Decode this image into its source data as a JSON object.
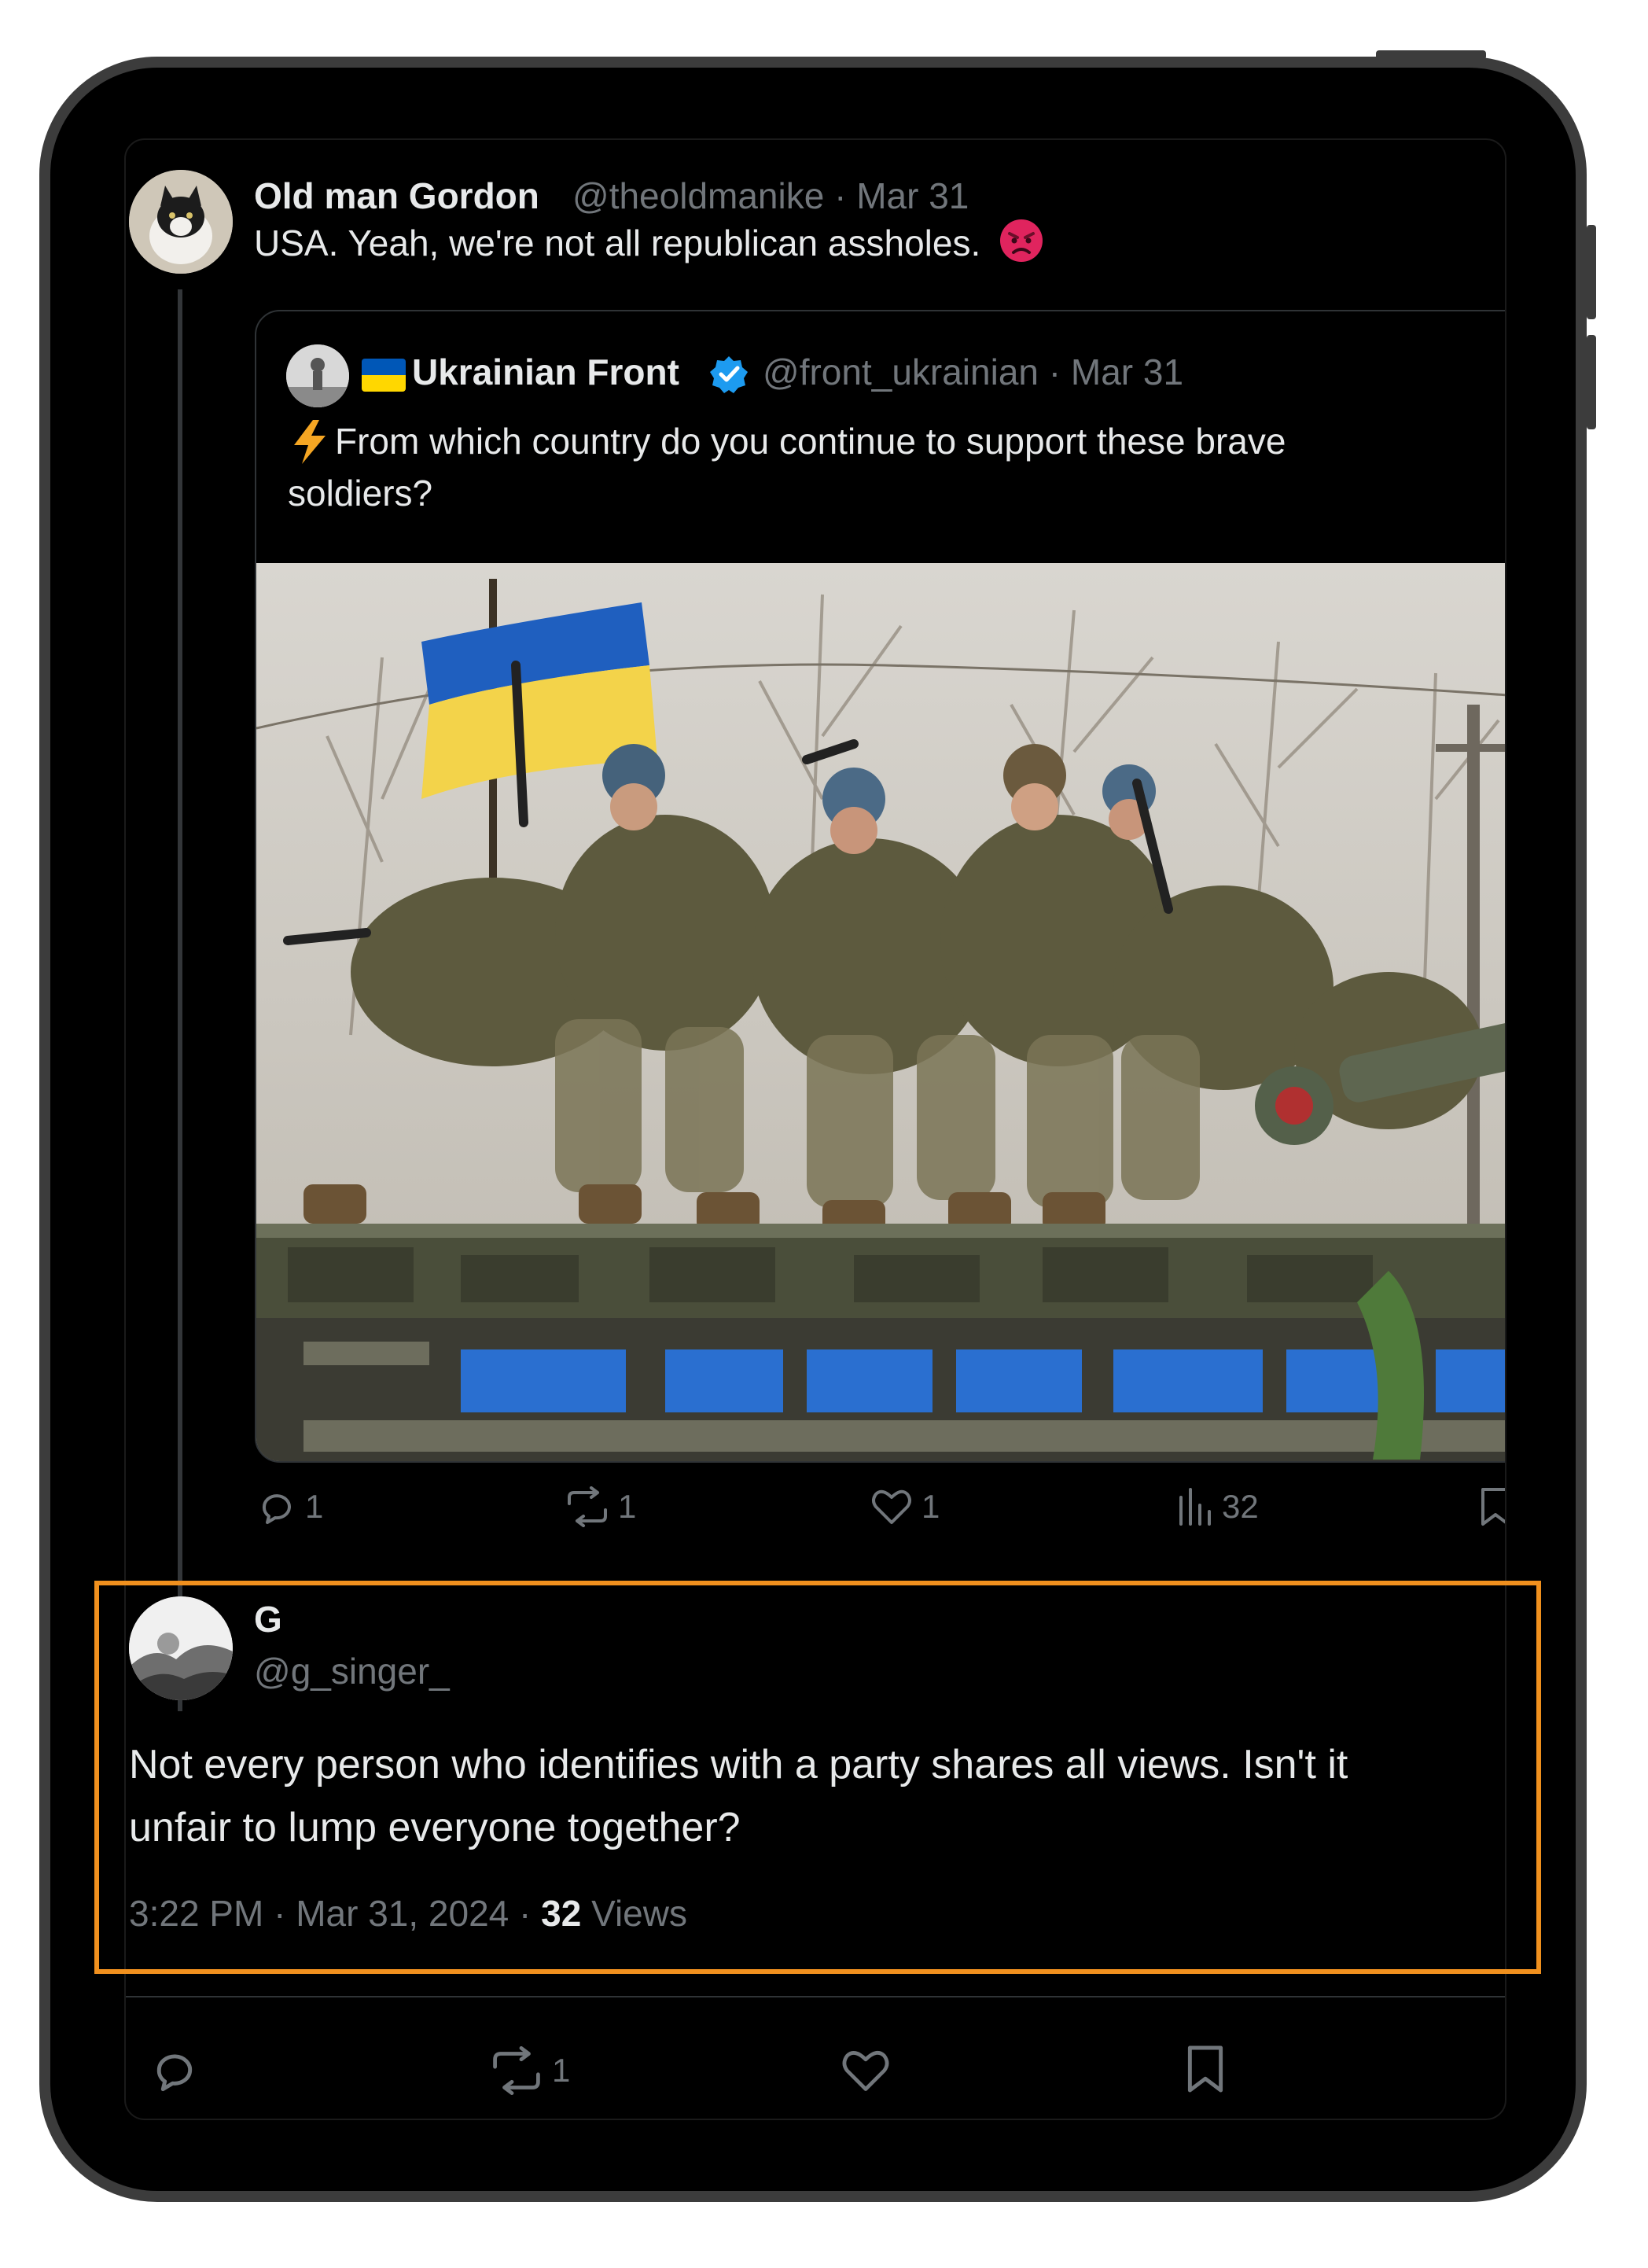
{
  "original_tweet": {
    "display_name": "Old man Gordon",
    "handle_date": "@theoldmanike · Mar 31",
    "text": "USA.  Yeah, we're not all republican assholes.",
    "emoji": "angry-face"
  },
  "quoted_tweet": {
    "flag": "ukraine-flag",
    "display_name": "Ukrainian Front",
    "verified": true,
    "handle_date": "@front_ukrainian · Mar 31",
    "text_line1": "From which country do you continue to support these brave",
    "text_line2": "soldiers?",
    "lead_emoji": "lightning"
  },
  "original_actions": {
    "replies": "1",
    "reposts": "1",
    "likes": "1",
    "views": "32"
  },
  "reply": {
    "display_name": "G",
    "handle": "@g_singer_",
    "text_line1": "Not every person who identifies with a party shares all views. Isn't it",
    "text_line2": "unfair to lump everyone together?",
    "timestamp": "3:22 PM · Mar 31, 2024 · ",
    "views_count": "32",
    "views_label": " Views"
  },
  "reply_actions": {
    "reposts": "1"
  },
  "colors": {
    "highlight": "#f0901e",
    "verified": "#1d9bf0",
    "background": "#000000"
  }
}
